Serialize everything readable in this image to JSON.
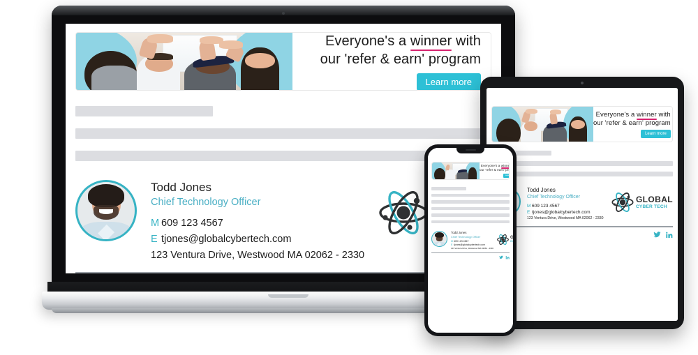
{
  "banner": {
    "headline_line1_pre": "Everyone's a ",
    "headline_line1_highlight": "winner",
    "headline_line1_post": " with",
    "headline_line2": "our 'refer & earn' program",
    "cta_label": "Learn more",
    "photo_alt": "team-high-five-photo",
    "accent_color": "#2dc0d6",
    "underline_color": "#d6236f"
  },
  "signature": {
    "name": "Todd Jones",
    "title": "Chief Technology Officer",
    "mobile_key": "M",
    "mobile_value": "609 123 4567",
    "email_key": "E",
    "email_value": "tjones@globalcybertech.com",
    "address": "123 Ventura Drive, Westwood MA 02062 - 2330",
    "avatar_alt": "user-avatar-photo",
    "title_color": "#4aafc4",
    "key_color": "#36b3c4"
  },
  "logo": {
    "mark": "atom-orbital-icon",
    "line1": "GLOBAL",
    "line2": "CYBER TECH",
    "line1_color": "#2e2e2e",
    "line2_color": "#36b3c4"
  },
  "socials": [
    {
      "name": "twitter-icon",
      "label": "Twitter"
    },
    {
      "name": "linkedin-icon",
      "label": "LinkedIn"
    }
  ],
  "devices": {
    "laptop": "laptop-mockup",
    "tablet": "tablet-mockup",
    "phone": "phone-mockup"
  }
}
